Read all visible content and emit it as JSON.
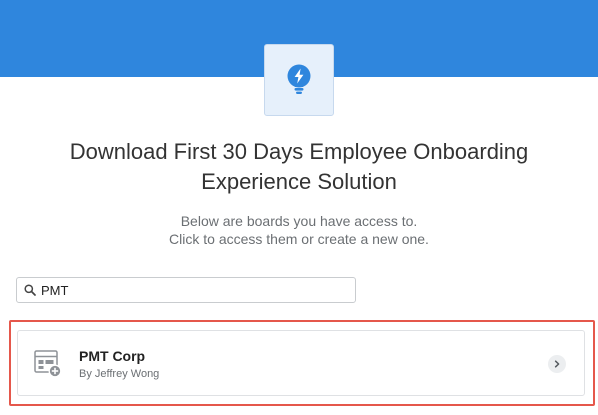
{
  "page": {
    "title": "Download First 30 Days Employee Onboarding Experience Solution",
    "subtitle_line1": "Below are boards you have access to.",
    "subtitle_line2": "Click to access them or create a new one."
  },
  "search": {
    "value": "PMT",
    "icon": "search-icon"
  },
  "boards": [
    {
      "name": "PMT Corp",
      "owner": "By Jeffrey Wong",
      "icon": "board-add-icon"
    }
  ],
  "colors": {
    "banner": "#2f86dd",
    "logo_tile": "#e6f0fb",
    "logo_icon": "#2f86dd",
    "highlight_border": "#e5574b"
  }
}
